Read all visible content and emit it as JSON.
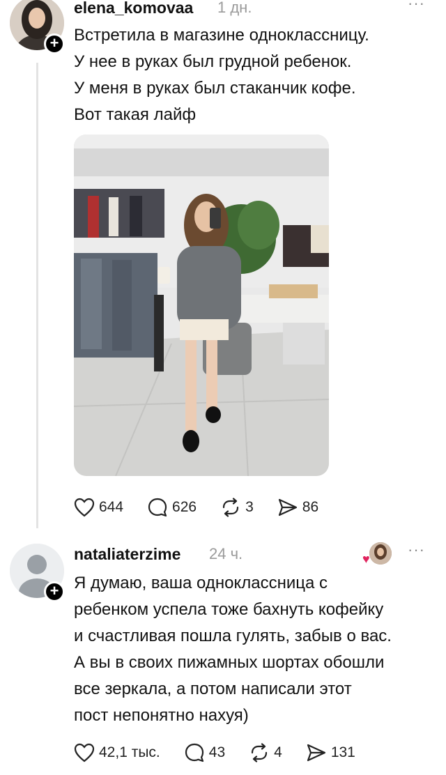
{
  "post": {
    "username": "elena_komovaa",
    "time": "1 дн.",
    "more": "···",
    "lines": [
      "Встретила в магазине одноклассницу.",
      "У нее в руках был грудной ребенок.",
      "У меня в руках был стаканчик кофе.",
      "Вот такая лайф"
    ],
    "likes": "644",
    "comments": "626",
    "reposts": "3",
    "shares": "86"
  },
  "reply": {
    "username": "nataliaterzime",
    "time": "24 ч.",
    "more": "···",
    "lines": [
      "Я думаю, ваша одноклассница с",
      "ребенком успела тоже бахнуть кофейку",
      "и счастливая пошла гулять, забыв о вас.",
      "А вы в своих пижамных шортах обошли",
      "все зеркала, а потом написали этот",
      "пост непонятно нахуя)"
    ],
    "likes": "42,1 тыс.",
    "comments": "43",
    "reposts": "4",
    "shares": "131"
  },
  "icons": {
    "like": "heart-icon",
    "comment": "comment-bubble-icon",
    "repost": "repost-icon",
    "share": "send-icon",
    "follow": "plus-icon",
    "more": "more-dots-icon"
  }
}
